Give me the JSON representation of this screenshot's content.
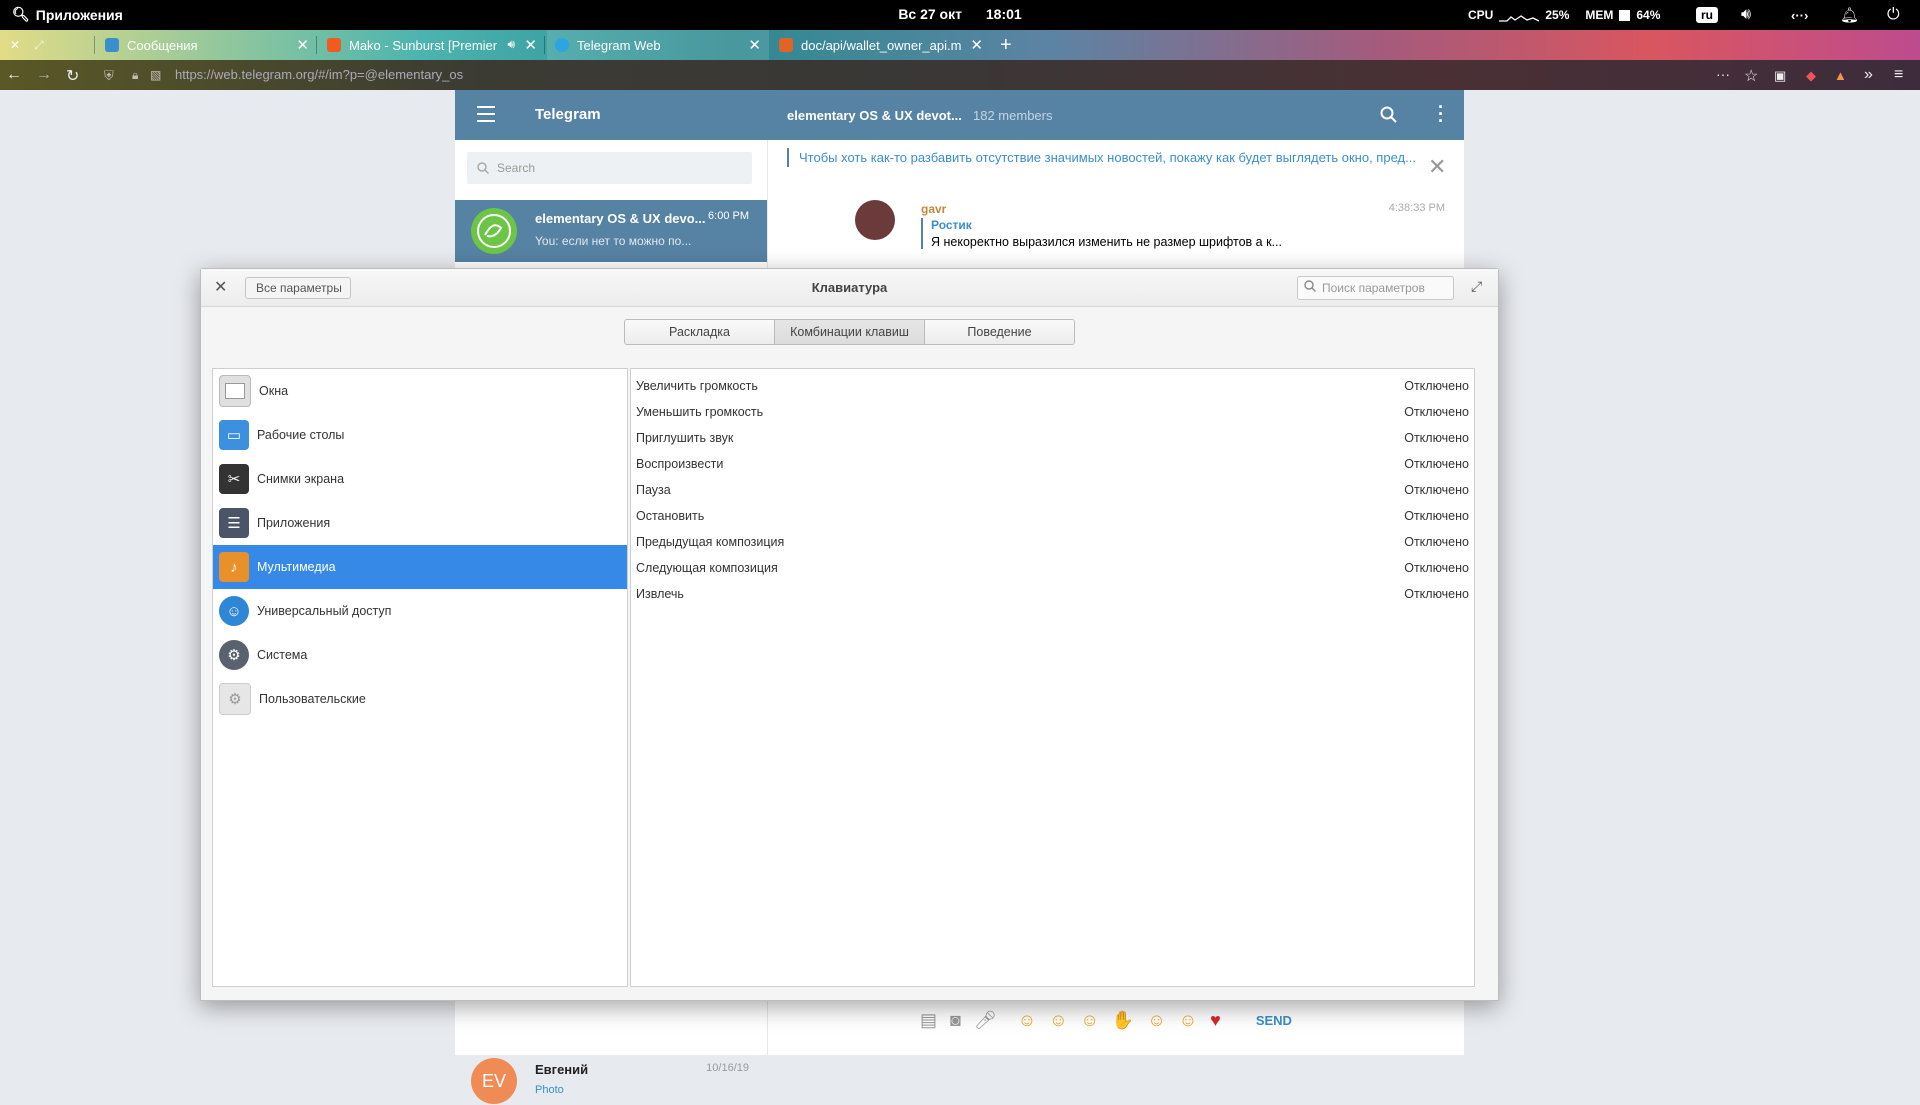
{
  "panel": {
    "apps_label": "Приложения",
    "date": "Вс 27 окт",
    "time": "18:01",
    "cpu_label": "CPU",
    "cpu_value": "25%",
    "mem_label": "MEM",
    "mem_value": "64%",
    "lang": "ru"
  },
  "browser": {
    "tabs": [
      {
        "label": "Сообщения",
        "color": "#3a8fca"
      },
      {
        "label": "Mako - Sunburst [Premier",
        "color": "#f25a22"
      },
      {
        "label": "Telegram Web",
        "color": "#2ca5e0"
      },
      {
        "label": "doc/api/wallet_owner_api.md",
        "color": "#e2632a"
      }
    ],
    "url": "https://web.telegram.org/#/im?p=@elementary_os"
  },
  "telegram": {
    "title": "Telegram",
    "chat_title": "elementary OS & UX devot...",
    "members": "182 members",
    "search_placeholder": "Search",
    "active_chat": {
      "name": "elementary OS & UX devo...",
      "time": "6:00 PM",
      "preview": "You: если нет то можно по..."
    },
    "pinned": "Чтобы хоть как-то разбавить отсутствие значимых новостей, покажу как будет выглядеть окно, пред...",
    "message": {
      "author": "gavr",
      "time": "4:38:33 PM",
      "reply_author": "Ростик",
      "reply_text": "Я некоректно выразился изменить не размер шрифтов а к..."
    },
    "bottom_chat": {
      "initials": "EV",
      "name": "Евгений",
      "time": "10/16/19",
      "preview": "Photo"
    },
    "send_label": "SEND"
  },
  "settings": {
    "back_label": "Все параметры",
    "title": "Клавиатура",
    "search_placeholder": "Поиск параметров",
    "tabs": [
      "Раскладка",
      "Комбинации клавиш",
      "Поведение"
    ],
    "categories": [
      {
        "label": "Окна",
        "icon": "windows-icon",
        "color": "#d8d8d8"
      },
      {
        "label": "Рабочие столы",
        "icon": "workspaces-icon",
        "color": "#3d8fe0"
      },
      {
        "label": "Снимки экрана",
        "icon": "screenshot-icon",
        "color": "#444444"
      },
      {
        "label": "Приложения",
        "icon": "applications-icon",
        "color": "#4a5568"
      },
      {
        "label": "Мультимедиа",
        "icon": "multimedia-icon",
        "color": "#e8902a"
      },
      {
        "label": "Универсальный доступ",
        "icon": "accessibility-icon",
        "color": "#2e86d6"
      },
      {
        "label": "Система",
        "icon": "system-icon",
        "color": "#5a6270"
      },
      {
        "label": "Пользовательские",
        "icon": "custom-icon",
        "color": "#cfcfcf"
      }
    ],
    "shortcuts": [
      {
        "name": "Увеличить громкость",
        "value": "Отключено"
      },
      {
        "name": "Уменьшить громкость",
        "value": "Отключено"
      },
      {
        "name": "Приглушить звук",
        "value": "Отключено"
      },
      {
        "name": "Воспроизвести",
        "value": "Отключено"
      },
      {
        "name": "Пауза",
        "value": "Отключено"
      },
      {
        "name": "Остановить",
        "value": "Отключено"
      },
      {
        "name": "Предыдущая композиция",
        "value": "Отключено"
      },
      {
        "name": "Следующая композиция",
        "value": "Отключено"
      },
      {
        "name": "Извлечь",
        "value": "Отключено"
      }
    ]
  }
}
